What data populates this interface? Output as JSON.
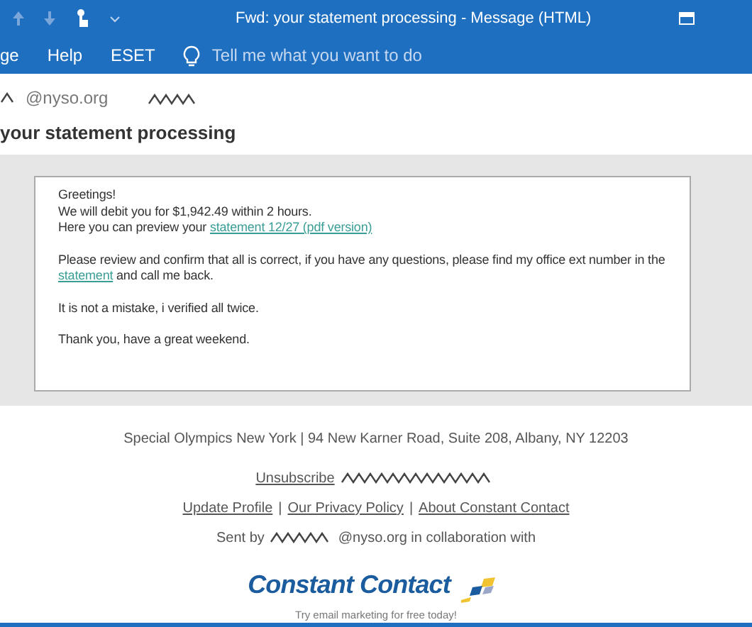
{
  "window": {
    "title": "Fwd: your statement processing  -  Message (HTML)"
  },
  "ribbon": {
    "tabs": [
      {
        "label": "ge"
      },
      {
        "label": "Help"
      },
      {
        "label": "ESET"
      }
    ],
    "tell_me": {
      "placeholder": "Tell me what you want to do"
    }
  },
  "header": {
    "sender_domain": "@nyso.org",
    "subject": "your statement processing"
  },
  "body": {
    "greeting": "Greetings!",
    "line_1": "We will debit you for $1,942.49 within 2 hours.",
    "line_2": "Here you can preview your",
    "link_1": "statement 12/27 (pdf version)",
    "para_2_start": "Please review and confirm that all is correct, if you have any questions, please find my office ext number in the",
    "link_2": "statement",
    "para_2_end": "and call me back.",
    "para_3": "It is not a mistake, i verified all twice.",
    "para_4": "Thank you, have a great weekend."
  },
  "footer": {
    "address": "Special Olympics New York | 94 New Karner Road, Suite 208, Albany, NY 12203",
    "unsubscribe": "Unsubscribe",
    "links": [
      "Update Profile",
      "Our Privacy Policy",
      "About Constant Contact"
    ],
    "separator": "|",
    "sent_by": "Sent by",
    "sent_domain": "@nyso.org in collaboration with",
    "logo": "Constant Contact",
    "tagline": "Try email marketing for free today!"
  }
}
